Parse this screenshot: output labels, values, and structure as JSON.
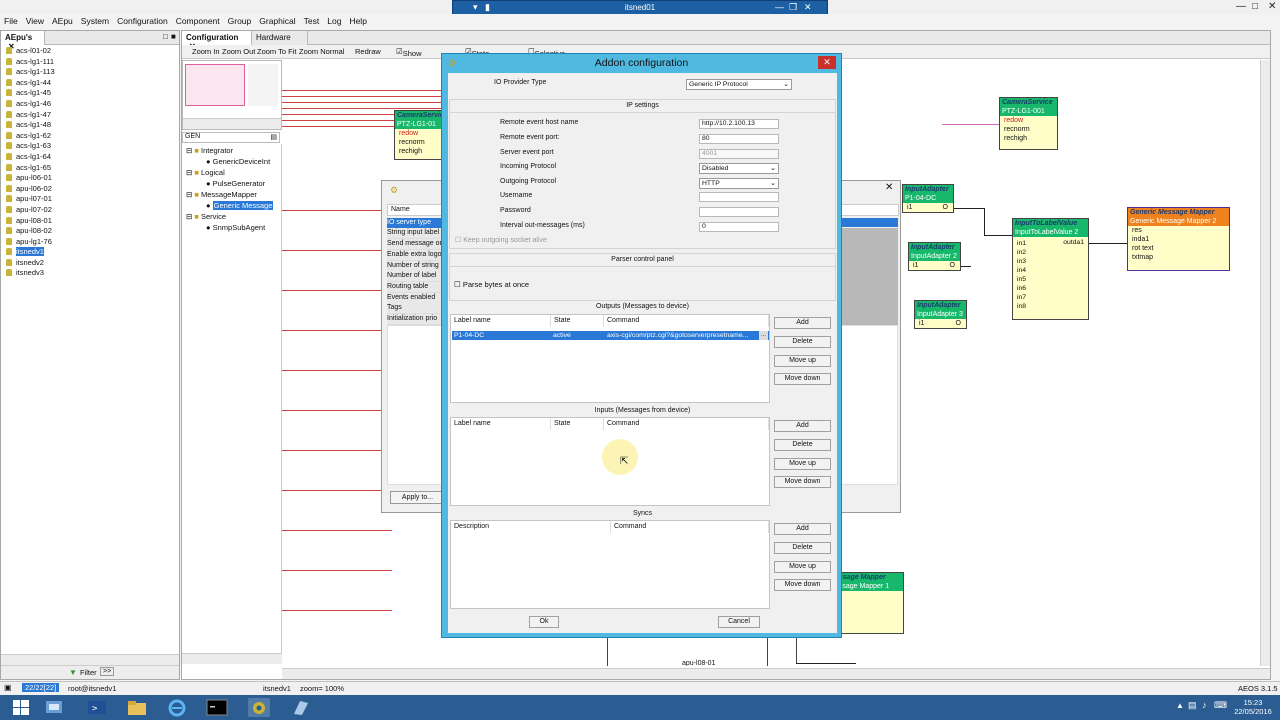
{
  "remote_session": {
    "title": "itsned01"
  },
  "menu": [
    "File",
    "View",
    "AEpu",
    "System",
    "Configuration",
    "Component",
    "Group",
    "Graphical",
    "Test",
    "Log",
    "Help"
  ],
  "left_panel": {
    "tab_label": "AEpu's",
    "items": [
      "acs-l01-02",
      "acs-lg1-111",
      "acs-lg1-113",
      "acs-lg1-44",
      "acs-lg1-45",
      "acs-lg1-46",
      "acs-lg1-47",
      "acs-lg1-48",
      "acs-lg1-62",
      "acs-lg1-63",
      "acs-lg1-64",
      "acs-lg1-65",
      "apu-l06-01",
      "apu-l06-02",
      "apu-l07-01",
      "apu-l07-02",
      "apu-l08-01",
      "apu-l08-02",
      "apu-lg1-76",
      "itsnedv1",
      "itsnedv2",
      "itsnedv3"
    ],
    "selected_index": 19,
    "filter_label": "Filter"
  },
  "config_panel": {
    "tabs": [
      "Configuration",
      "Hardware"
    ],
    "toolbar": {
      "zoom_in": "Zoom In",
      "zoom_out": "Zoom Out",
      "zoom_fit": "Zoom To Fit",
      "zoom_normal": "Zoom Normal",
      "redraw": "Redraw",
      "show_groups": "Show Groups",
      "state_monitor": "State Monitor",
      "selective": "Selective"
    },
    "tree_search": "GEN",
    "tree": [
      {
        "label": "Integrator",
        "level": 0
      },
      {
        "label": "GenericDeviceInt",
        "level": 1
      },
      {
        "label": "Logical",
        "level": 0
      },
      {
        "label": "PulseGenerator",
        "level": 1
      },
      {
        "label": "MessageMapper",
        "level": 0
      },
      {
        "label": "Generic Message",
        "level": 1,
        "selected": true
      },
      {
        "label": "Service",
        "level": 0
      },
      {
        "label": "SnmpSubAgent",
        "level": 1
      }
    ]
  },
  "diagram": {
    "camera_service_1": {
      "title": "CameraService",
      "sub": "PTZ-LG1-01",
      "ports": [
        "redow",
        "recnorm",
        "rechigh"
      ]
    },
    "camera_service_2": {
      "title": "CameraService",
      "sub": "PTZ-LG1-001",
      "ports": [
        "redow",
        "recnorm",
        "rechigh"
      ]
    },
    "input_adapter_1": {
      "title": "InputAdapter",
      "sub": "P1-04-DC",
      "ports": [
        "i1",
        "O"
      ]
    },
    "input_adapter_2": {
      "title": "InputAdapter",
      "sub": "InputAdapter 2",
      "ports": [
        "i1",
        "O"
      ]
    },
    "input_adapter_3": {
      "title": "InputAdapter",
      "sub": "InputAdapter 3",
      "ports": [
        "i1",
        "O"
      ]
    },
    "input_to_label": {
      "title": "InputToLabelValue",
      "sub": "InputToLabelValue 2",
      "ports_in": [
        "in1",
        "in2",
        "in3",
        "in4",
        "in5",
        "in6",
        "in7",
        "in8"
      ],
      "port_out": "outda1"
    },
    "gmm": {
      "title": "Generic Message Mapper",
      "sub": "Generic Message Mapper 2",
      "ports": [
        "res",
        "inda1",
        "rot text",
        "txtmap"
      ]
    },
    "gmm_partial": {
      "title": "essage Mapper",
      "sub": "essage Mapper 1"
    },
    "apu_label": "apu-l08-01"
  },
  "behind_dialog": {
    "col_header": "Name",
    "rows": [
      "IO server type",
      "String input label",
      "Send message on",
      "Enable extra logo",
      "Number of string",
      "Number of label",
      "Routing table",
      "Events enabled",
      "Tags",
      "Initialization prio"
    ],
    "apply_label": "Apply to..."
  },
  "addon_dialog": {
    "title": "Addon configuration",
    "io_provider_label": "IO Provider Type",
    "io_provider_value": "Generic IP Protocol",
    "ip_settings_title": "IP settings",
    "fields": [
      {
        "label": "Remote event host name",
        "value": "http://10.2.100.13",
        "type": "text"
      },
      {
        "label": "Remote event port:",
        "value": "80",
        "type": "text"
      },
      {
        "label": "Server event port",
        "value": "4001",
        "type": "disabled"
      },
      {
        "label": "Incoming Protocol",
        "value": "Disabled",
        "type": "select"
      },
      {
        "label": "Outgoing Protocol",
        "value": "HTTP",
        "type": "select"
      },
      {
        "label": "Username",
        "value": "",
        "type": "text"
      },
      {
        "label": "Password",
        "value": "",
        "type": "text"
      },
      {
        "label": "Interval out-messages (ms)",
        "value": "0",
        "type": "text"
      }
    ],
    "keep_alive_label": "Keep outgoing socket alive",
    "parser_title": "Parser control panel",
    "parse_bytes_label": "Parse bytes at once",
    "outputs": {
      "title": "Outputs (Messages to device)",
      "headers": [
        "Label name",
        "State",
        "Command"
      ],
      "rows": [
        {
          "label": "P1-04-DC",
          "state": "active",
          "command": "axis-cgi/com/ptz.cgi?&gotoserverpresetname..."
        }
      ]
    },
    "inputs": {
      "title": "Inputs (Messages from device)",
      "headers": [
        "Label name",
        "State",
        "Command"
      ],
      "rows": []
    },
    "syncs": {
      "title": "Syncs",
      "headers": [
        "Description",
        "Command"
      ]
    },
    "buttons": {
      "add": "Add",
      "delete": "Delete",
      "move_up": "Move up",
      "move_down": "Move down"
    },
    "ok_label": "Ok",
    "cancel_label": "Cancel"
  },
  "status_bar": {
    "counter": "22/22[22]",
    "user": "root@itsnedv1",
    "node": "itsnedv1",
    "zoom": "zoom= 100%",
    "version": "AEOS 3.1.5"
  },
  "taskbar": {
    "time": "15:23",
    "date": "22/05/2016"
  }
}
